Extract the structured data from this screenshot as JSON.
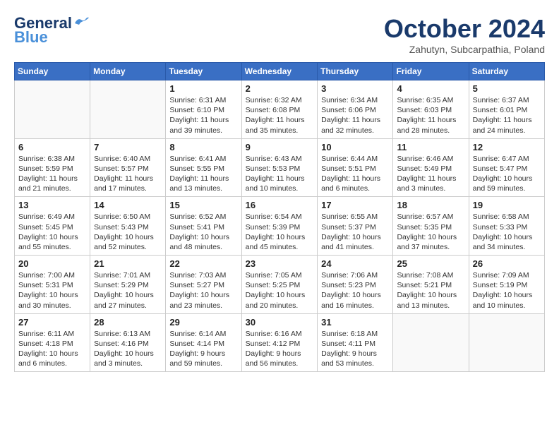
{
  "header": {
    "logo_general": "General",
    "logo_blue": "Blue",
    "month": "October 2024",
    "location": "Zahutyn, Subcarpathia, Poland"
  },
  "days_of_week": [
    "Sunday",
    "Monday",
    "Tuesday",
    "Wednesday",
    "Thursday",
    "Friday",
    "Saturday"
  ],
  "weeks": [
    [
      {
        "day": "",
        "info": ""
      },
      {
        "day": "",
        "info": ""
      },
      {
        "day": "1",
        "info": "Sunrise: 6:31 AM\nSunset: 6:10 PM\nDaylight: 11 hours and 39 minutes."
      },
      {
        "day": "2",
        "info": "Sunrise: 6:32 AM\nSunset: 6:08 PM\nDaylight: 11 hours and 35 minutes."
      },
      {
        "day": "3",
        "info": "Sunrise: 6:34 AM\nSunset: 6:06 PM\nDaylight: 11 hours and 32 minutes."
      },
      {
        "day": "4",
        "info": "Sunrise: 6:35 AM\nSunset: 6:03 PM\nDaylight: 11 hours and 28 minutes."
      },
      {
        "day": "5",
        "info": "Sunrise: 6:37 AM\nSunset: 6:01 PM\nDaylight: 11 hours and 24 minutes."
      }
    ],
    [
      {
        "day": "6",
        "info": "Sunrise: 6:38 AM\nSunset: 5:59 PM\nDaylight: 11 hours and 21 minutes."
      },
      {
        "day": "7",
        "info": "Sunrise: 6:40 AM\nSunset: 5:57 PM\nDaylight: 11 hours and 17 minutes."
      },
      {
        "day": "8",
        "info": "Sunrise: 6:41 AM\nSunset: 5:55 PM\nDaylight: 11 hours and 13 minutes."
      },
      {
        "day": "9",
        "info": "Sunrise: 6:43 AM\nSunset: 5:53 PM\nDaylight: 11 hours and 10 minutes."
      },
      {
        "day": "10",
        "info": "Sunrise: 6:44 AM\nSunset: 5:51 PM\nDaylight: 11 hours and 6 minutes."
      },
      {
        "day": "11",
        "info": "Sunrise: 6:46 AM\nSunset: 5:49 PM\nDaylight: 11 hours and 3 minutes."
      },
      {
        "day": "12",
        "info": "Sunrise: 6:47 AM\nSunset: 5:47 PM\nDaylight: 10 hours and 59 minutes."
      }
    ],
    [
      {
        "day": "13",
        "info": "Sunrise: 6:49 AM\nSunset: 5:45 PM\nDaylight: 10 hours and 55 minutes."
      },
      {
        "day": "14",
        "info": "Sunrise: 6:50 AM\nSunset: 5:43 PM\nDaylight: 10 hours and 52 minutes."
      },
      {
        "day": "15",
        "info": "Sunrise: 6:52 AM\nSunset: 5:41 PM\nDaylight: 10 hours and 48 minutes."
      },
      {
        "day": "16",
        "info": "Sunrise: 6:54 AM\nSunset: 5:39 PM\nDaylight: 10 hours and 45 minutes."
      },
      {
        "day": "17",
        "info": "Sunrise: 6:55 AM\nSunset: 5:37 PM\nDaylight: 10 hours and 41 minutes."
      },
      {
        "day": "18",
        "info": "Sunrise: 6:57 AM\nSunset: 5:35 PM\nDaylight: 10 hours and 37 minutes."
      },
      {
        "day": "19",
        "info": "Sunrise: 6:58 AM\nSunset: 5:33 PM\nDaylight: 10 hours and 34 minutes."
      }
    ],
    [
      {
        "day": "20",
        "info": "Sunrise: 7:00 AM\nSunset: 5:31 PM\nDaylight: 10 hours and 30 minutes."
      },
      {
        "day": "21",
        "info": "Sunrise: 7:01 AM\nSunset: 5:29 PM\nDaylight: 10 hours and 27 minutes."
      },
      {
        "day": "22",
        "info": "Sunrise: 7:03 AM\nSunset: 5:27 PM\nDaylight: 10 hours and 23 minutes."
      },
      {
        "day": "23",
        "info": "Sunrise: 7:05 AM\nSunset: 5:25 PM\nDaylight: 10 hours and 20 minutes."
      },
      {
        "day": "24",
        "info": "Sunrise: 7:06 AM\nSunset: 5:23 PM\nDaylight: 10 hours and 16 minutes."
      },
      {
        "day": "25",
        "info": "Sunrise: 7:08 AM\nSunset: 5:21 PM\nDaylight: 10 hours and 13 minutes."
      },
      {
        "day": "26",
        "info": "Sunrise: 7:09 AM\nSunset: 5:19 PM\nDaylight: 10 hours and 10 minutes."
      }
    ],
    [
      {
        "day": "27",
        "info": "Sunrise: 6:11 AM\nSunset: 4:18 PM\nDaylight: 10 hours and 6 minutes."
      },
      {
        "day": "28",
        "info": "Sunrise: 6:13 AM\nSunset: 4:16 PM\nDaylight: 10 hours and 3 minutes."
      },
      {
        "day": "29",
        "info": "Sunrise: 6:14 AM\nSunset: 4:14 PM\nDaylight: 9 hours and 59 minutes."
      },
      {
        "day": "30",
        "info": "Sunrise: 6:16 AM\nSunset: 4:12 PM\nDaylight: 9 hours and 56 minutes."
      },
      {
        "day": "31",
        "info": "Sunrise: 6:18 AM\nSunset: 4:11 PM\nDaylight: 9 hours and 53 minutes."
      },
      {
        "day": "",
        "info": ""
      },
      {
        "day": "",
        "info": ""
      }
    ]
  ]
}
